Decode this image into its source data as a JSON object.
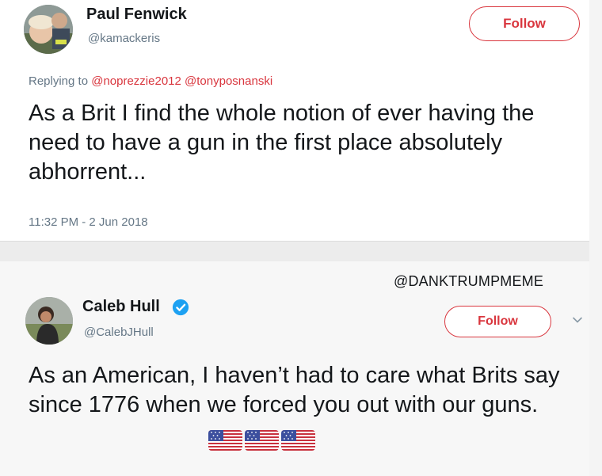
{
  "tweet1": {
    "name": "Paul Fenwick",
    "handle": "@kamackeris",
    "follow_label": "Follow",
    "replying_prefix": "Replying to ",
    "mention1": "@noprezzie2012",
    "mention2": "@tonyposnanski",
    "text": "As a Brit I find the whole notion of ever having the need to have a gun in the first place absolutely abhorrent...",
    "timestamp": "11:32 PM - 2 Jun 2018"
  },
  "watermark": "@DANKTRUMPMEME",
  "tweet2": {
    "name": "Caleb Hull",
    "handle": "@CalebJHull",
    "follow_label": "Follow",
    "text": "As an American, I haven’t had to care what Brits say since 1776 when we forced you out with our guns.",
    "emoji": [
      "us-flag",
      "us-flag",
      "us-flag"
    ]
  },
  "colors": {
    "accent_red": "#d9363e",
    "verified_blue": "#1da1f2",
    "secondary_text": "#657786"
  }
}
